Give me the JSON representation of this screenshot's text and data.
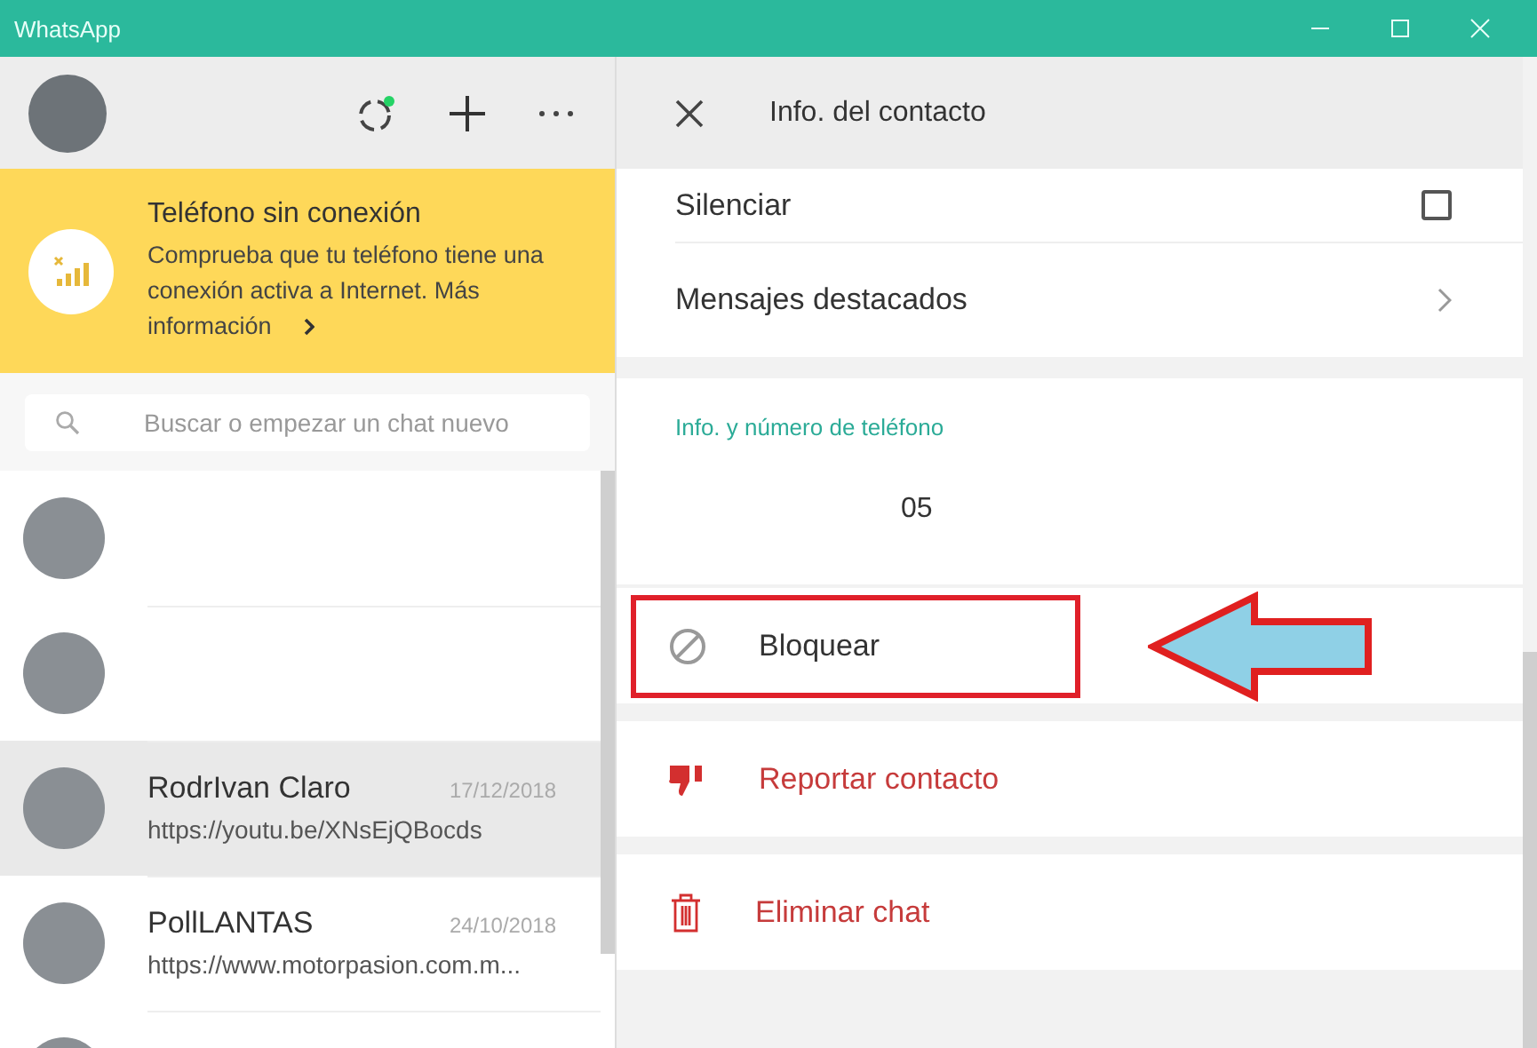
{
  "window": {
    "title": "WhatsApp"
  },
  "banner": {
    "title": "Teléfono sin conexión",
    "text": "Comprueba que tu teléfono tiene una conexión activa a Internet. Más información"
  },
  "search": {
    "placeholder": "Buscar o empezar un chat nuevo"
  },
  "chats": [
    {
      "selected": false
    },
    {
      "selected": false
    },
    {
      "name": "RodrIvan Claro",
      "date": "17/12/2018",
      "preview": "https://youtu.be/XNsEjQBocds",
      "selected": true
    },
    {
      "name": "PollLANTAS",
      "date": "24/10/2018",
      "preview": "https://www.motorpasion.com.m...",
      "selected": false
    },
    {
      "selected": false
    }
  ],
  "contact_info": {
    "title": "Info. del contacto",
    "mute": {
      "label": "Silenciar",
      "checked": false
    },
    "starred": {
      "label": "Mensajes destacados"
    },
    "phone_section": {
      "label": "Info. y número de teléfono",
      "value": "05"
    },
    "actions": [
      {
        "kind": "block",
        "label": "Bloquear",
        "highlighted": true
      },
      {
        "kind": "report",
        "label": "Reportar contacto",
        "highlighted": false
      },
      {
        "kind": "delete",
        "label": "Eliminar chat",
        "highlighted": false
      }
    ]
  }
}
